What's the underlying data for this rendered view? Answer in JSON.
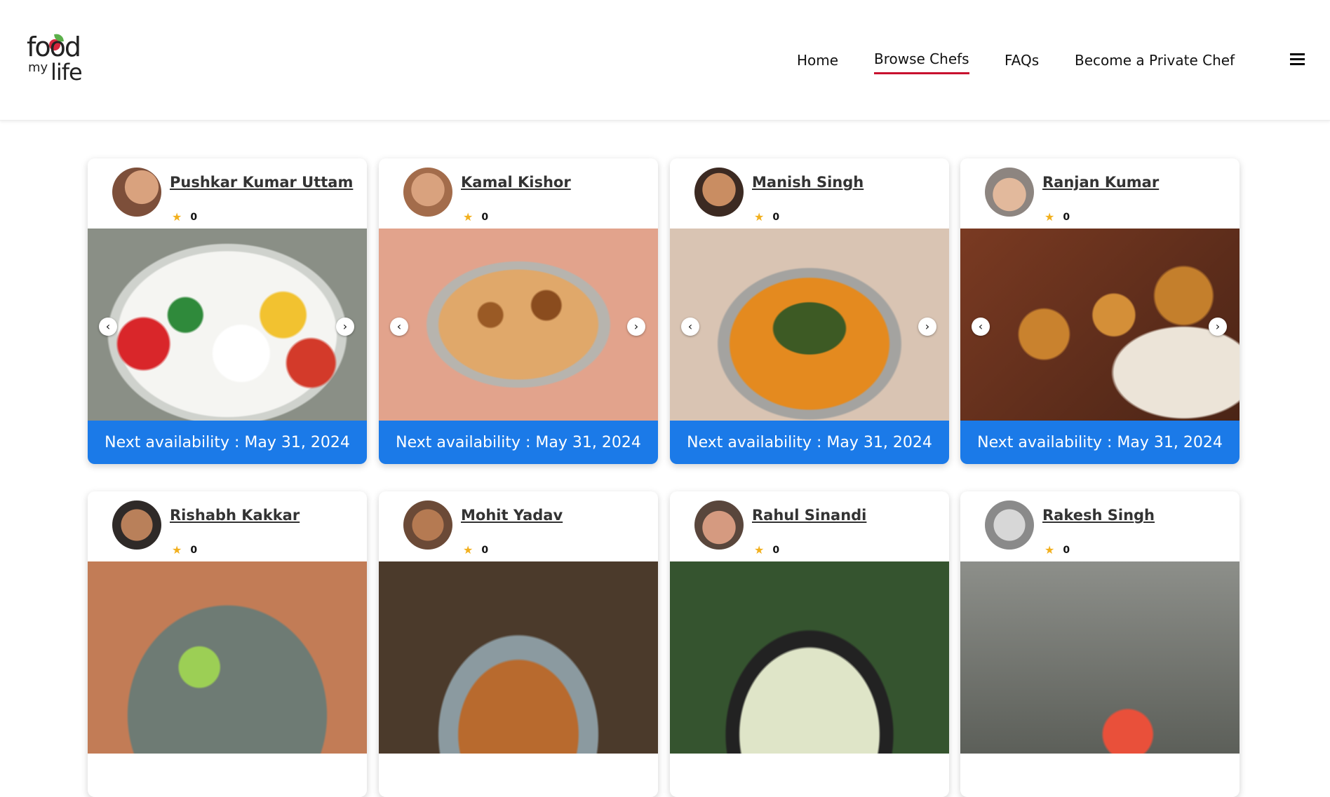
{
  "header": {
    "logo": {
      "line1": "food",
      "line2": "my",
      "line3": "life"
    },
    "nav": [
      {
        "label": "Home",
        "active": false
      },
      {
        "label": "Browse Chefs",
        "active": true
      },
      {
        "label": "FAQs",
        "active": false
      },
      {
        "label": "Become a Private Chef",
        "active": false
      }
    ],
    "menu_icon": "hamburger-icon",
    "accent_color": "#c8102e"
  },
  "cards": [
    {
      "name": "Pushkar Kumar Uttam",
      "rating": "0",
      "availability": "Next availability : May 31, 2024"
    },
    {
      "name": "Kamal Kishor",
      "rating": "0",
      "availability": "Next availability : May 31, 2024"
    },
    {
      "name": "Manish Singh",
      "rating": "0",
      "availability": "Next availability : May 31, 2024"
    },
    {
      "name": "Ranjan Kumar",
      "rating": "0",
      "availability": "Next availability : May 31, 2024"
    },
    {
      "name": "Rishabh Kakkar",
      "rating": "0",
      "availability": ""
    },
    {
      "name": "Mohit Yadav",
      "rating": "0",
      "availability": ""
    },
    {
      "name": "Rahul Sinandi",
      "rating": "0",
      "availability": ""
    },
    {
      "name": "Rakesh Singh",
      "rating": "0",
      "availability": ""
    }
  ],
  "icons": {
    "star": "star-icon",
    "prev": "chevron-left-icon",
    "next": "chevron-right-icon"
  },
  "colors": {
    "availability_bar": "#1b7ae8",
    "star": "#f2b01e"
  }
}
